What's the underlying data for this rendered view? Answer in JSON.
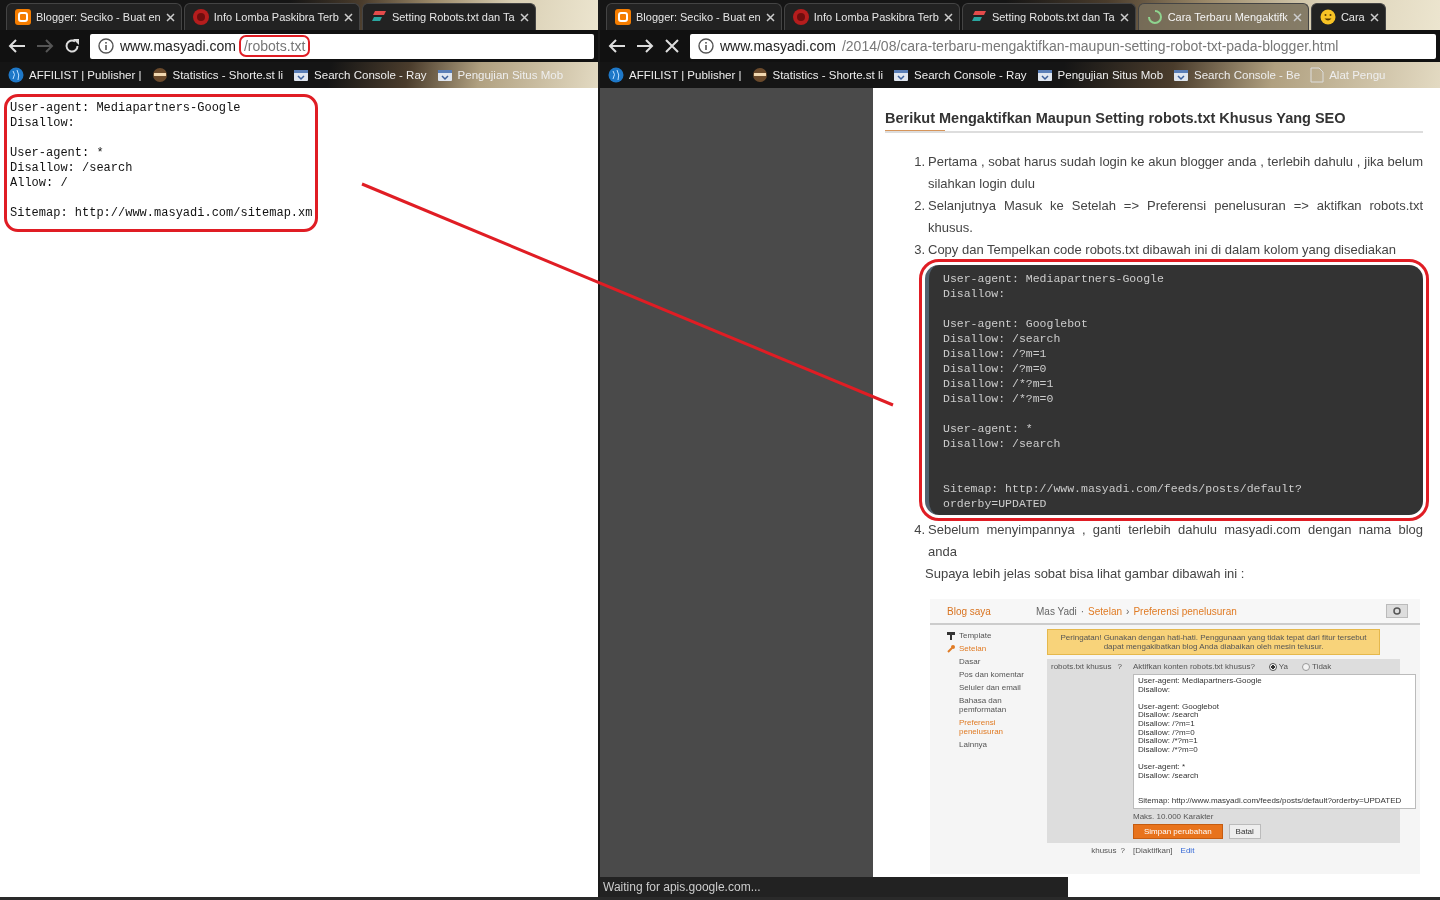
{
  "windows": [
    {
      "tabs": [
        {
          "title": "Blogger: Seciko - Buat en",
          "kind": "blogger",
          "selected": false
        },
        {
          "title": "Info Lomba Paskibra Terb",
          "kind": "seal",
          "selected": false
        },
        {
          "title": "Setting Robots.txt dan Ta",
          "kind": "stripes",
          "selected": false
        }
      ],
      "nav": {
        "forward_enabled": false,
        "loading": false
      },
      "address": {
        "host": "www.masyadi.com",
        "path": "/robots.txt",
        "highlighted": true
      },
      "bookmarks": [
        {
          "label": "AFFILIST | Publisher |",
          "kind": "globe"
        },
        {
          "label": "Statistics - Shorte.st li",
          "kind": "ninja"
        },
        {
          "label": "Search Console - Ray",
          "kind": "console"
        },
        {
          "label": "Pengujian Situs Mob",
          "kind": "console"
        }
      ],
      "content": {
        "kind": "plain_text",
        "highlighted": true,
        "text": "User-agent: Mediapartners-Google\nDisallow:\n\nUser-agent: *\nDisallow: /search\nAllow: /\n\nSitemap: http://www.masyadi.com/sitemap.xm"
      }
    },
    {
      "tabs": [
        {
          "title": "Blogger: Seciko - Buat en",
          "kind": "blogger",
          "selected": false
        },
        {
          "title": "Info Lomba Paskibra Terb",
          "kind": "seal",
          "selected": false
        },
        {
          "title": "Setting Robots.txt dan Ta",
          "kind": "stripes",
          "selected": false
        },
        {
          "title": "Cara Terbaru Mengaktifk",
          "kind": "spinner",
          "selected": true
        },
        {
          "title": "Cara",
          "kind": "emoji",
          "selected": false
        }
      ],
      "nav": {
        "forward_enabled": true,
        "loading": true
      },
      "address": {
        "host": "www.masyadi.com",
        "path": "/2014/08/cara-terbaru-mengaktifkan-maupun-setting-robot-txt-pada-blogger.html",
        "highlighted": false
      },
      "bookmarks": [
        {
          "label": "AFFILIST | Publisher |",
          "kind": "globe"
        },
        {
          "label": "Statistics - Shorte.st li",
          "kind": "ninja"
        },
        {
          "label": "Search Console - Ray",
          "kind": "console"
        },
        {
          "label": "Pengujian Situs Mob",
          "kind": "console"
        },
        {
          "label": "Search Console - Be",
          "kind": "console"
        },
        {
          "label": "Alat Pengu",
          "kind": "page"
        }
      ],
      "content": {
        "kind": "article",
        "blocks": [
          {
            "kind": "heading",
            "text": "Berikut Mengaktifkan Maupun Setting robots.txt Khusus Yang SEO"
          },
          {
            "kind": "step",
            "number": "1.",
            "text": "Pertama , sobat harus sudah login ke akun blogger anda , terlebih dahulu , jika belum silahkan login dulu"
          },
          {
            "kind": "step",
            "number": "2.",
            "text": "Selanjutnya Masuk ke Setelah => Preferensi penelusuran => aktifkan robots.txt khusus."
          },
          {
            "kind": "step",
            "number": "3.",
            "text": "Copy dan Tempelkan code robots.txt  dibawah ini di dalam kolom yang disediakan"
          },
          {
            "kind": "code",
            "highlighted": true,
            "text": "User-agent: Mediapartners-Google\nDisallow:\n\nUser-agent: Googlebot\nDisallow: /search\nDisallow: /?m=1\nDisallow: /?m=0\nDisallow: /*?m=1\nDisallow: /*?m=0\n\nUser-agent: *\nDisallow: /search\n\n\nSitemap: http://www.masyadi.com/feeds/posts/default?\norderby=UPDATED"
          },
          {
            "kind": "step",
            "number": "4.",
            "text": "Sebelum menyimpannya , ganti terlebih dahulu masyadi.com dengan nama blog anda"
          },
          {
            "kind": "paragraph",
            "text": "Supaya lebih jelas sobat bisa lihat gambar dibawah ini :"
          },
          {
            "kind": "screenshot",
            "shot": {
              "brand": "Blog saya",
              "breadcrumb": [
                {
                  "text": "Mas Yadi",
                  "link": false,
                  "separator_after": "·"
                },
                {
                  "text": "Setelan",
                  "link": true,
                  "separator_after": "›"
                },
                {
                  "text": "Preferensi penelusuran",
                  "link": true
                }
              ],
              "sidebar": [
                {
                  "label": "Template",
                  "kind": "roller",
                  "selected": false
                },
                {
                  "label": "Setelan",
                  "kind": "wrench",
                  "selected": true,
                  "children": [
                    {
                      "label": "Dasar",
                      "selected": false
                    },
                    {
                      "label": "Pos dan komentar",
                      "selected": false
                    },
                    {
                      "label": "Seluler dan email",
                      "selected": false
                    },
                    {
                      "label": "Bahasa dan pemformatan",
                      "selected": false
                    },
                    {
                      "label": "Preferensi penelusuran",
                      "selected": true
                    },
                    {
                      "label": "Lainnya",
                      "selected": false
                    }
                  ]
                }
              ],
              "warning": "Peringatan! Gunakan dengan hati-hati. Penggunaan yang tidak tepat dari fitur tersebut dapat mengakibatkan blog Anda diabaikan oleh mesin telusur.",
              "setting_label": "robots.txt khusus",
              "help": "?",
              "question": "Aktifkan konten robots.txt khusus?",
              "options": [
                {
                  "label": "Ya",
                  "selected": true
                },
                {
                  "label": "Tidak",
                  "selected": false
                }
              ],
              "textarea": "User-agent: Mediapartners-Google\nDisallow:\n\nUser-agent: Googlebot\nDisallow: /search\nDisallow: /?m=1\nDisallow: /?m=0\nDisallow: /*?m=1\nDisallow: /*?m=0\n\nUser-agent: *\nDisallow: /search\n\n\nSitemap: http://www.masyadi.com/feeds/posts/default?orderby=UPDATED",
              "limit_note": "Maks. 10.000 Karakter",
              "buttons": [
                {
                  "label": "Simpan perubahan",
                  "kind": "primary"
                },
                {
                  "label": "Batal",
                  "kind": "secondary"
                }
              ],
              "next_row": {
                "label": "khusus",
                "help": "?",
                "value": "[Diaktifkan]",
                "link": "Edit"
              }
            }
          }
        ]
      },
      "status_bar": "Waiting for apis.google.com..."
    }
  ]
}
